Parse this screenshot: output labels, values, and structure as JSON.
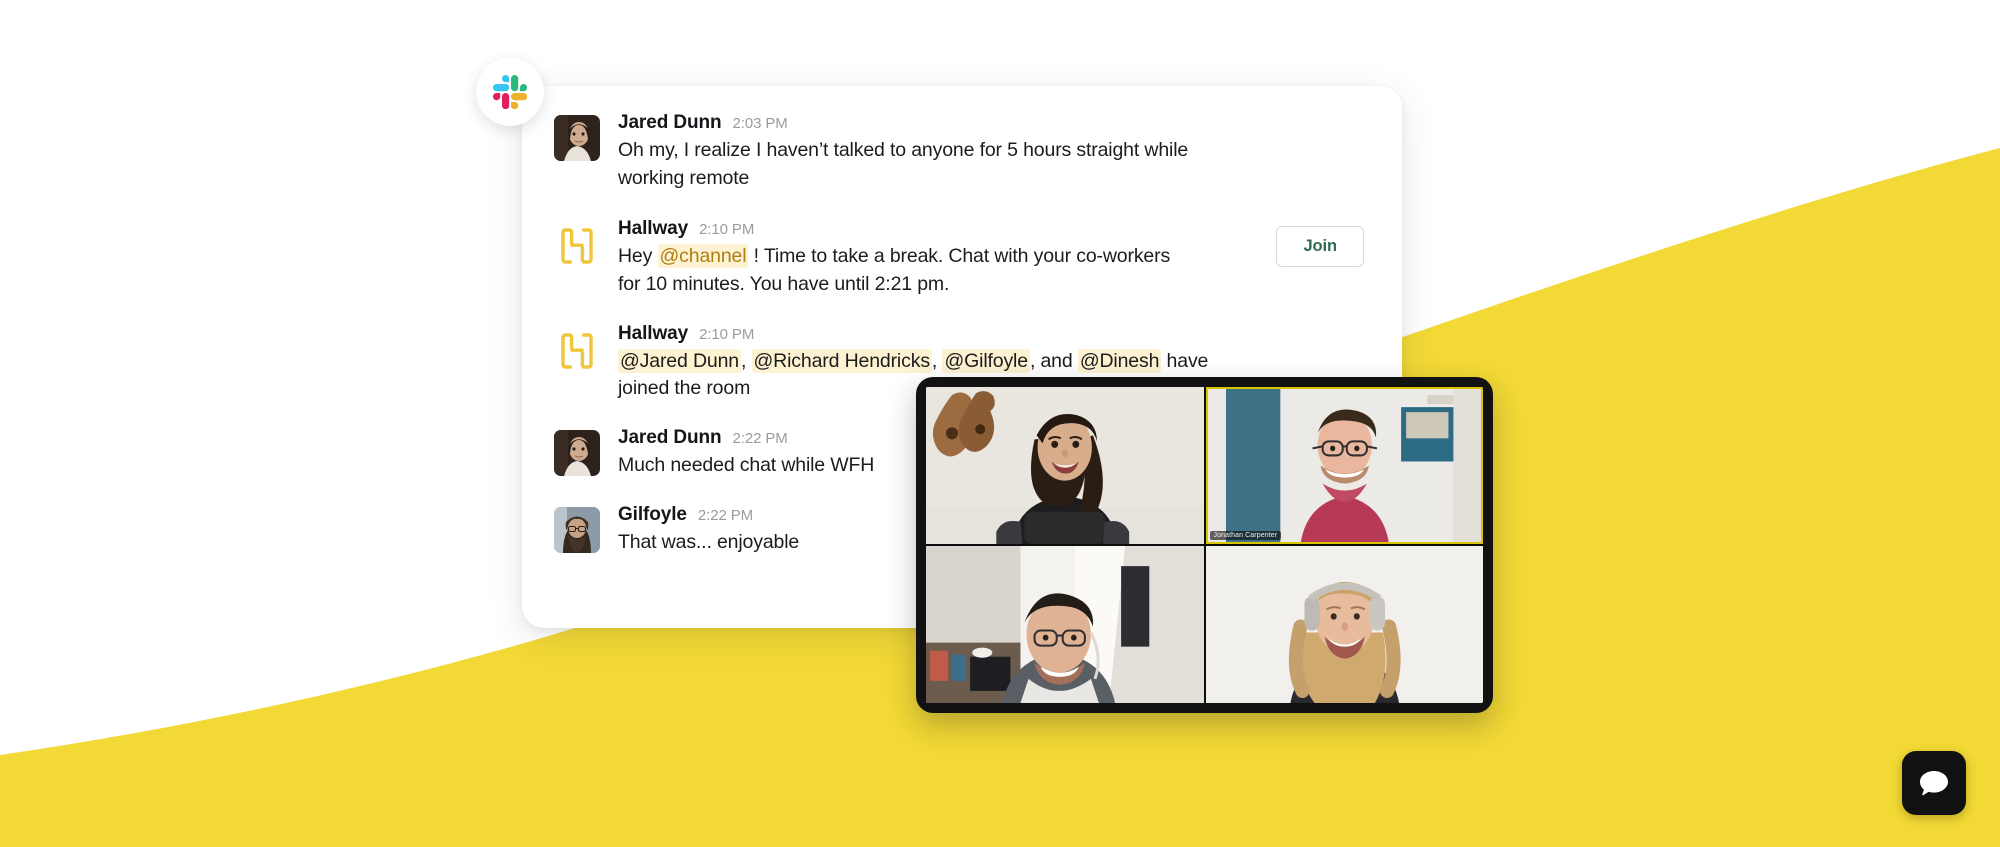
{
  "theme": {
    "background_color": "#FFFFFF",
    "accent_yellow": "#F2D935",
    "card_background": "#FFFFFF",
    "mention_highlight": "#FDF3D3",
    "join_button_text": "#2F6B4F",
    "chat_widget_background": "#111111"
  },
  "app_badge": {
    "icon": "slack-logo-icon",
    "label": "Slack"
  },
  "conversation": {
    "messages": [
      {
        "author": "Jared Dunn",
        "time": "2:03 PM",
        "avatar": "jared-dunn-avatar",
        "text": "Oh my, I realize I haven’t talked to anyone for 5 hours straight while working remote",
        "action": null
      },
      {
        "author": "Hallway",
        "time": "2:10 PM",
        "avatar": "hallway-logo-icon",
        "text_before": "Hey ",
        "mention": "@channel",
        "text_after": " ! Time to take a break. Chat with your co-workers for 10 minutes.  You have until 2:21 pm.",
        "action": "Join"
      },
      {
        "author": "Hallway",
        "time": "2:10 PM",
        "avatar": "hallway-logo-icon",
        "mentions": [
          "@Jared Dunn",
          "@Richard Hendricks",
          "@Gilfoyle",
          "@Dinesh"
        ],
        "sep1": ", ",
        "sep2": ", ",
        "sep3": ", and ",
        "text_after": " have joined the room",
        "action": null
      },
      {
        "author": "Jared Dunn",
        "time": "2:22 PM",
        "avatar": "jared-dunn-avatar",
        "text": "Much needed chat while WFH",
        "action": null
      },
      {
        "author": "Gilfoyle",
        "time": "2:22 PM",
        "avatar": "gilfoyle-avatar",
        "text": "That was... enjoyable",
        "action": null
      }
    ]
  },
  "video_call": {
    "participants": [
      {
        "position": "top-left",
        "name": "",
        "active": false
      },
      {
        "position": "top-right",
        "name": "Jonathan Carpenter",
        "active": true
      },
      {
        "position": "bottom-left",
        "name": "",
        "active": false
      },
      {
        "position": "bottom-right",
        "name": "",
        "active": false
      }
    ]
  },
  "chat_widget": {
    "icon": "chat-bubble-icon",
    "label": "Open chat"
  }
}
